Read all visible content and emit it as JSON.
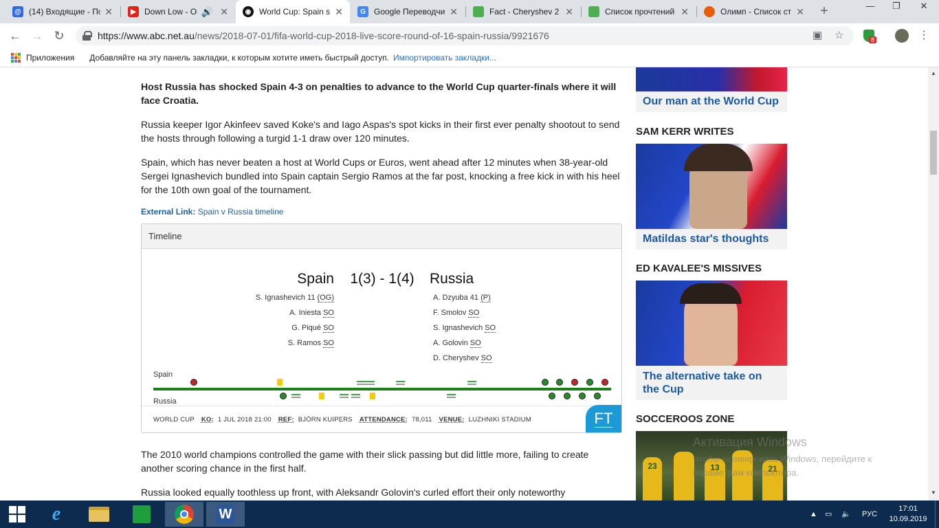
{
  "browser": {
    "tabs": [
      {
        "title": "(14) Входящие - По",
        "favicon_color": "#2d6ae8"
      },
      {
        "title": "Down Low - Or",
        "favicon_color": "#e62117"
      },
      {
        "title": "World Cup: Spain s",
        "favicon_color": "#111111"
      },
      {
        "title": "Google Переводчи",
        "favicon_color": "#4285f4"
      },
      {
        "title": "Fact - Cheryshev 2",
        "favicon_color": "#4caf50"
      },
      {
        "title": "Список прочтений",
        "favicon_color": "#4caf50"
      },
      {
        "title": "Олимп - Список ст",
        "favicon_color": "#e85d04"
      }
    ],
    "new_tab": "+",
    "url_host": "https://www.abc.net.au",
    "url_path": "/news/2018-07-01/fifa-world-cup-2018-live-score-round-of-16-spain-russia/9921676",
    "extension_badge": "8",
    "bookmarks": {
      "apps": "Приложения",
      "hint": "Добавляйте на эту панель закладки, к которым хотите иметь быстрый доступ.",
      "import": "Импортировать закладки..."
    }
  },
  "article": {
    "lead": "Host Russia has shocked Spain 4-3 on penalties to advance to the World Cup quarter-finals where it will face Croatia.",
    "p1": "Russia keeper Igor Akinfeev saved Koke's and Iago Aspas's spot kicks in their first ever penalty shootout to send the hosts through following a turgid 1-1 draw over 120 minutes.",
    "p2": "Spain, which has never beaten a host at World Cups or Euros, went ahead after 12 minutes when 38-year-old Sergei Ignashevich bundled into Spain captain Sergio Ramos at the far post, knocking a free kick in with his heel for the 10th own goal of the tournament.",
    "ext_label": "External Link:",
    "ext_text": "Spain v Russia timeline",
    "p3": "The 2010 world champions controlled the game with their slick passing but did little more, failing to create another scoring chance in the first half.",
    "p4": "Russia looked equally toothless up front, with Aleksandr Golovin's curled effort their only noteworthy"
  },
  "timeline": {
    "header": "Timeline",
    "home": "Spain",
    "away": "Russia",
    "score": "1(3) - 1(4)",
    "home_scorers": [
      {
        "name": "S. Ignashevich 11",
        "tag": "(OG)"
      },
      {
        "name": "A. Iniesta",
        "tag": "SO"
      },
      {
        "name": "G. Piqué",
        "tag": "SO"
      },
      {
        "name": "S. Ramos",
        "tag": "SO"
      }
    ],
    "away_scorers": [
      {
        "name": "A. Dzyuba 41",
        "tag": "(P)"
      },
      {
        "name": "F. Smolov",
        "tag": "SO"
      },
      {
        "name": "S. Ignashevich",
        "tag": "SO"
      },
      {
        "name": "A. Golovin",
        "tag": "SO"
      },
      {
        "name": "D. Cheryshev",
        "tag": "SO"
      }
    ],
    "home_label": "Spain",
    "away_label": "Russia",
    "footer": {
      "competition": "WORLD CUP",
      "ko_label": "KO:",
      "ko_value": "1 JUL 2018 21:00",
      "ref_label": "REF:",
      "ref_value": "BJÖRN KUIPERS",
      "att_label": "ATTENDANCE:",
      "att_value": "78,011",
      "venue_label": "VENUE:",
      "venue_value": "LUZHNIKI STADIUM"
    },
    "badge": "FT",
    "colors": {
      "goal": "#2a8a2a",
      "miss": "#c0262b",
      "yellow": "#f6cb12",
      "bar": "#1e7e1e"
    }
  },
  "sidebar": {
    "card1_caption": "Our man at the World Cup",
    "sec2": "SAM KERR WRITES",
    "card2_caption": "Matildas star's thoughts",
    "sec3": "ED KAVALEE'S MISSIVES",
    "card3_caption": "The alternative take on the Cup",
    "sec4": "SOCCEROOS ZONE",
    "socceroos_numbers": [
      "23",
      "13",
      "21"
    ]
  },
  "watermark": {
    "line1": "Активация Windows",
    "line2": "Чтобы активировать Windows, перейдите к параметрам компьютера."
  },
  "taskbar": {
    "lang": "РУС",
    "time": "17:01",
    "date": "10.09.2019"
  }
}
